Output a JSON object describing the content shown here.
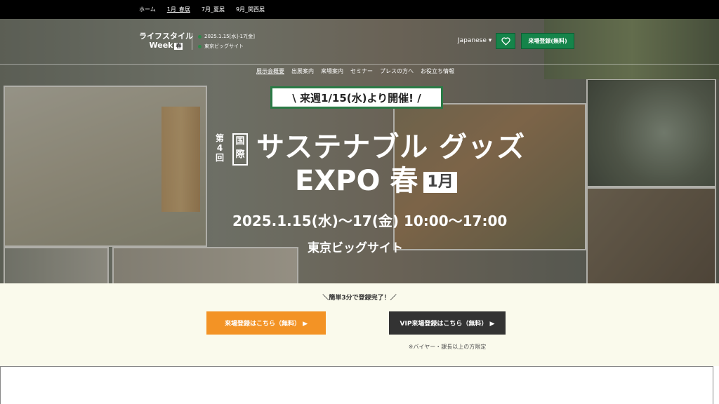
{
  "topnav": {
    "items": [
      "ホーム",
      "1月_春展",
      "7月_夏展",
      "9月_関西展"
    ]
  },
  "header": {
    "logo_line1": "ライフスタイル",
    "logo_line2": "Week",
    "logo_badge": "春",
    "date_text": "2025.1.15[水]-17[金]",
    "venue_text": "東京ビッグサイト",
    "language": "Japanese",
    "heart_icon": "heart-icon",
    "register_button": "来場登録(無料)"
  },
  "mainnav": {
    "items": [
      "展示会概要",
      "出展案内",
      "来場案内",
      "セミナー",
      "プレスの方へ",
      "お役立ち情報"
    ]
  },
  "hero": {
    "announce": "\\ 来週1/15(水)より開催! /",
    "edition_chars": [
      "第",
      "4",
      "回"
    ],
    "kokusai_chars": [
      "国",
      "際"
    ],
    "title_line1": "サステナブル グッズ",
    "title_line2": "EXPO 春",
    "month_badge": "1月",
    "event_date": "2025.1.15(水)～17(金)  10:00～17:00",
    "venue": "東京ビッグサイト"
  },
  "registration": {
    "note": "＼簡単3分で登録完了！／",
    "visitor_button": "来場登録はこちら（無料） ▶",
    "vip_button": "VIP来場登録はこちら（無料） ▶",
    "vip_note": "※バイヤー・課長以上の方限定"
  },
  "colors": {
    "accent_green": "#15844a",
    "orange": "#f39325",
    "dark": "#333333"
  }
}
